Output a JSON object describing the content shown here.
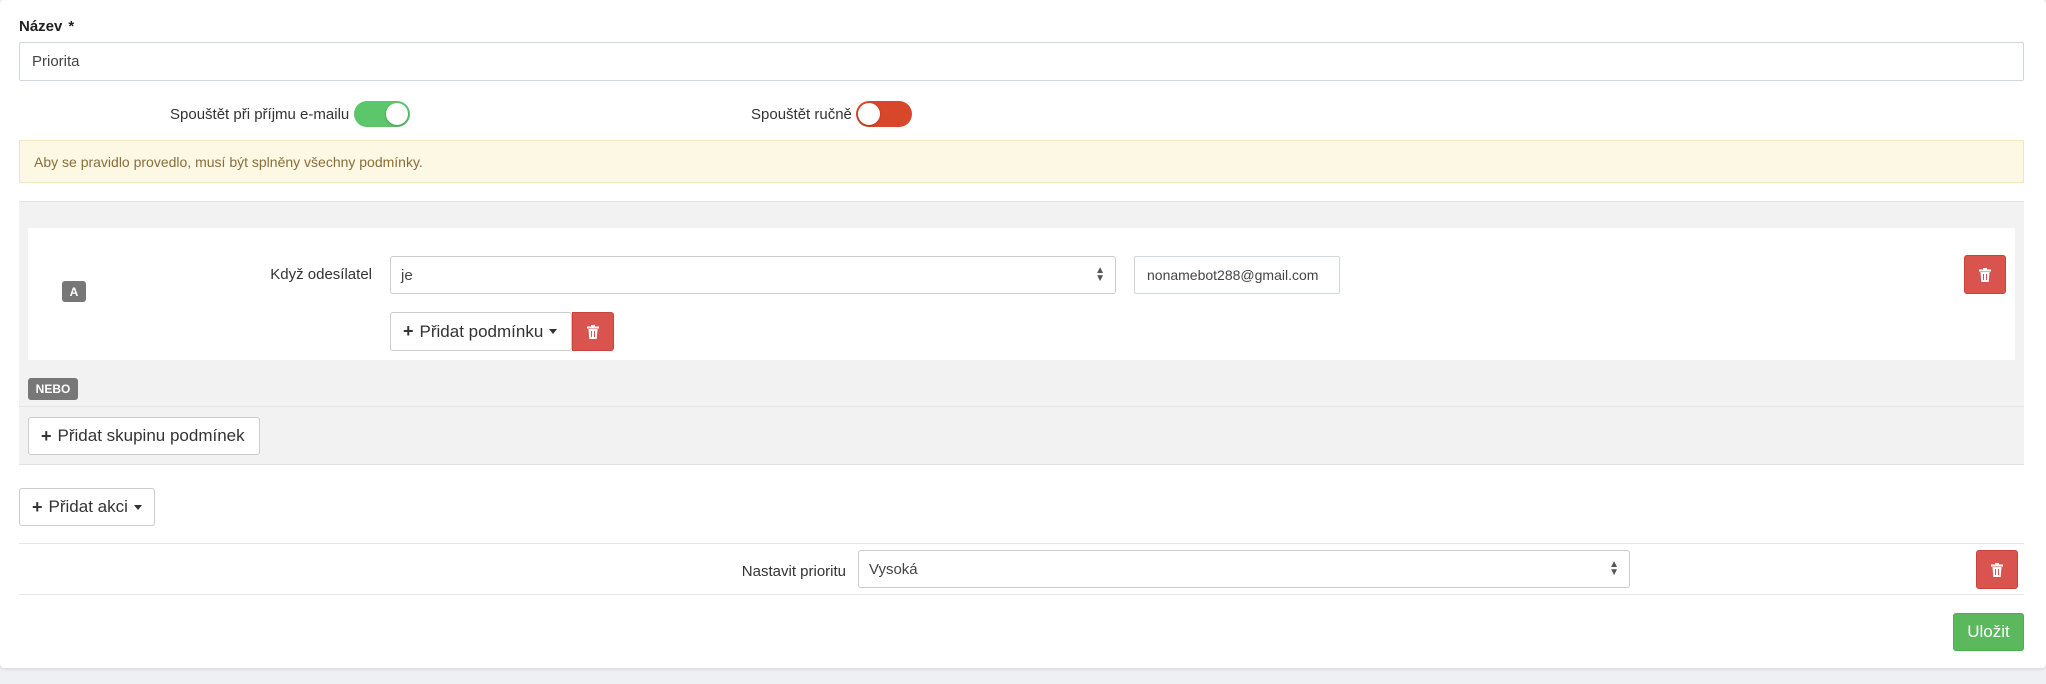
{
  "form": {
    "name_label": "Název",
    "required_mark": "*",
    "name_value": "Priorita"
  },
  "toggles": {
    "on_email": {
      "label": "Spouštět při příjmu e-mailu",
      "enabled": true,
      "color": "#5cc66a"
    },
    "manual": {
      "label": "Spouštět ručně",
      "enabled": false,
      "color": "#d9472b"
    }
  },
  "alert": {
    "text": "Aby se pravidlo provedlo, musí být splněny všechny podmínky."
  },
  "condition_group": {
    "badge": "A",
    "condition_label": "Když odesílatel",
    "operator_value": "je",
    "value": "nonamebot288@gmail.com",
    "add_condition_label": "Přidat podmínku"
  },
  "or_badge": "NEBO",
  "add_group_label": "Přidat skupinu podmínek",
  "add_action_label": "Přidat akci",
  "action": {
    "label": "Nastavit prioritu",
    "value": "Vysoká"
  },
  "save_label": "Uložit",
  "colors": {
    "danger": "#d9534f",
    "success": "#5cb85c",
    "alert_bg": "#fcf8e3"
  }
}
